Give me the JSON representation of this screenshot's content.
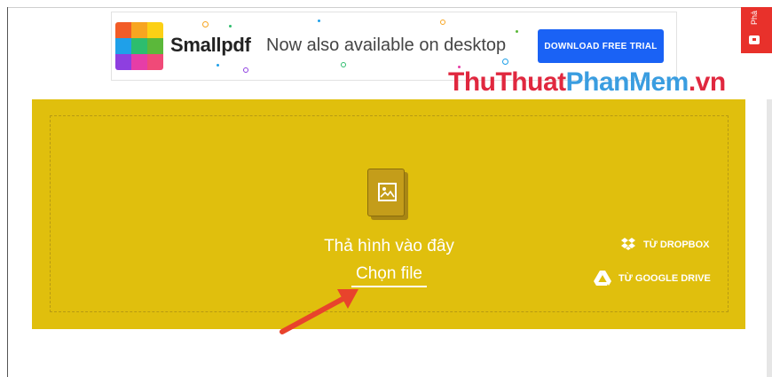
{
  "ad": {
    "brand": "Smallpdf",
    "tagline": "Now also available on desktop",
    "cta": "DOWNLOAD FREE TRIAL",
    "logo_colors": [
      "#f25c27",
      "#f7a520",
      "#fcd015",
      "#1fa0e9",
      "#2dbd6e",
      "#5bb83a",
      "#8e3fe0",
      "#e63da7",
      "#f04a78"
    ]
  },
  "side_tab": {
    "text": "Phả"
  },
  "watermark": {
    "part1": "ThuThuat",
    "part2": "PhanMem",
    "part3": ".vn"
  },
  "dropzone": {
    "drop_text": "Thả hình vào đây",
    "choose_file": "Chọn file",
    "dropbox": "TỪ DROPBOX",
    "google_drive": "TỪ GOOGLE DRIVE",
    "bg_color": "#e0bf0d"
  }
}
